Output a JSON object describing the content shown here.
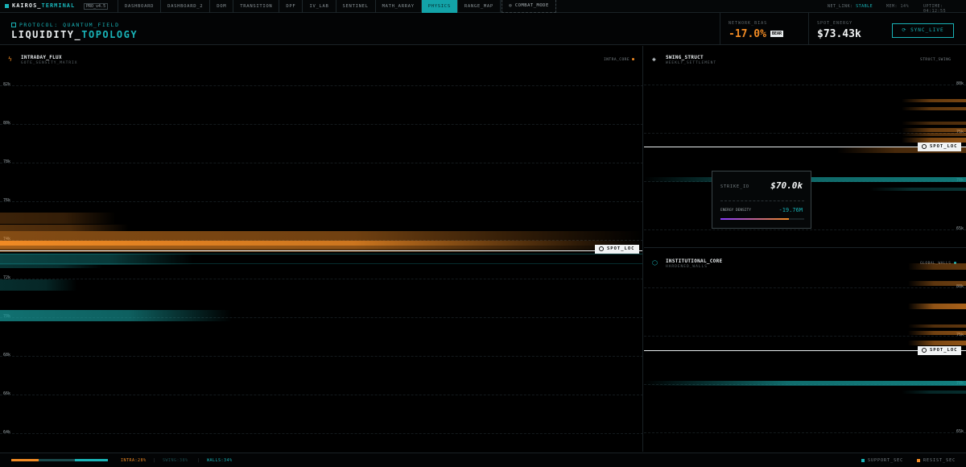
{
  "app": {
    "brand_prefix": "KAIROS_",
    "brand_suffix": "TERMINAL",
    "version": "PRO_v4.5",
    "accent": "#19b4b8",
    "warm": "#f08a24"
  },
  "nav": {
    "tabs": [
      "DASHBOARD",
      "DASHBOARD_2",
      "DOM",
      "TRANSITION",
      "DPF",
      "IV_LAB",
      "SENTINEL",
      "MATH_ARRAY",
      "PHYSICS",
      "RANGE_MAP"
    ],
    "active": "PHYSICS",
    "combat_label": "COMBAT_MODE"
  },
  "status": {
    "net_label": "NET_LINK:",
    "net_value": "STABLE",
    "mem": "MEM: 14%",
    "uptime": "UPTIME: 04:12:55"
  },
  "header": {
    "protocol": "PROTOCOL: QUANTUM_FIELD",
    "title_a": "LIQUIDITY_",
    "title_b": "TOPOLOGY",
    "bias_label": "NETWORK_BIAS",
    "bias_value": "-17.0%",
    "bias_badge": "BEAR",
    "spot_label": "SPOT_ENERGY",
    "spot_value": "$73.43k",
    "sync_label": "SYNC_LIVE"
  },
  "panels": {
    "intraday": {
      "title": "INTRADAY_FLUX",
      "subtitle": "GOTE_SENSITY_MATRIX",
      "tag": "INTRA_CORE",
      "y_labels": [
        "82k",
        "80k",
        "78k",
        "76k",
        "74k",
        "72k",
        "70k",
        "68k",
        "66k",
        "64k"
      ],
      "spot_tag": "SPOT_LOC"
    },
    "swing": {
      "title": "SWING_STRUCT",
      "subtitle": "WEEKLY_SETTLEMENT",
      "tag": "STRUCT_SWING",
      "y_labels": [
        "80k",
        "75k",
        "70k",
        "65k"
      ],
      "spot_tag": "SPOT_LOC"
    },
    "institutional": {
      "title": "INSTITUTIONAL_CORE",
      "subtitle": "HARDENED_WALLS",
      "tag": "GLOBAL_WALLS",
      "y_labels": [
        "80k",
        "75k",
        "70k",
        "65k"
      ],
      "spot_tag": "SPOT_LOC"
    }
  },
  "tooltip": {
    "strike_label": "STRIKE_ID",
    "strike_value": "$70.0k",
    "density_label": "ENERGY DENSITY",
    "density_value": "-19.76M",
    "density_level": 0.82
  },
  "footer": {
    "intra": "INTRA:28%",
    "swing": "SWING:38%",
    "walls": "WALLS:34%",
    "intra_pct": 28,
    "swing_pct": 38,
    "walls_pct": 34,
    "support": "SUPPORT_SEC",
    "resist": "RESIST_SEC"
  }
}
